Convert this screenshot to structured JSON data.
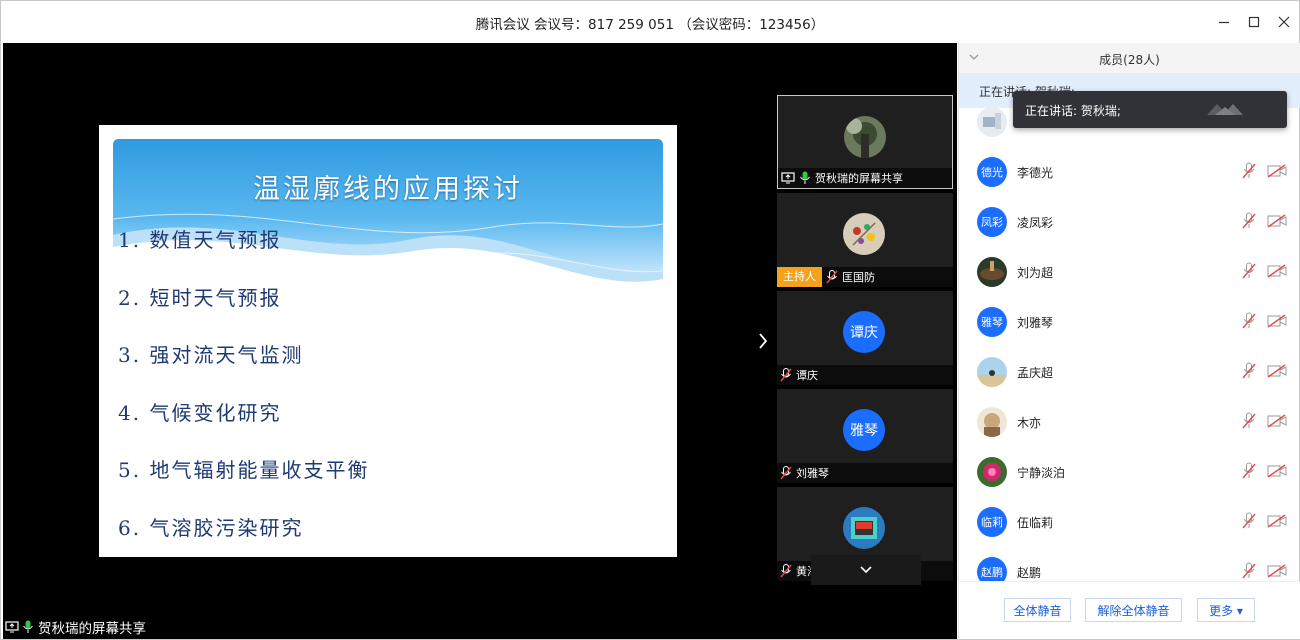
{
  "window": {
    "title": "腾讯会议 会议号：817 259 051 （会议密码：123456）"
  },
  "slide": {
    "title": "温湿廓线的应用探讨",
    "items": [
      "1. 数值天气预报",
      "2. 短时天气预报",
      "3. 强对流天气监测",
      "4. 气候变化研究",
      "5. 地气辐射能量收支平衡",
      "6. 气溶胶污染研究"
    ]
  },
  "tiles": [
    {
      "label": "贺秋瑞的屏幕共享",
      "avatar_text": ""
    },
    {
      "label": "匡国防",
      "host_badge": "主持人",
      "avatar_text": ""
    },
    {
      "label": "谭庆",
      "avatar_text": "谭庆"
    },
    {
      "label": "刘雅琴",
      "avatar_text": "雅琴"
    },
    {
      "label": "黄海平",
      "avatar_text": ""
    }
  ],
  "share_footer": "贺秋瑞的屏幕共享",
  "panel": {
    "title": "成员(28人)",
    "speaking": "正在讲话: 贺秋瑞;",
    "tooltip": "正在讲话: 贺秋瑞;",
    "members": [
      {
        "name": "",
        "avatar_text": ""
      },
      {
        "name": "李德光",
        "avatar_text": "德光"
      },
      {
        "name": "凌凤彩",
        "avatar_text": "凤彩"
      },
      {
        "name": "刘为超",
        "avatar_text": ""
      },
      {
        "name": "刘雅琴",
        "avatar_text": "雅琴"
      },
      {
        "name": "孟庆超",
        "avatar_text": ""
      },
      {
        "name": "木亦",
        "avatar_text": ""
      },
      {
        "name": "宁静淡泊",
        "avatar_text": ""
      },
      {
        "name": "伍临莉",
        "avatar_text": "临莉"
      },
      {
        "name": "赵鹏",
        "avatar_text": "赵鹏"
      }
    ],
    "buttons": {
      "mute_all": "全体静音",
      "unmute_all": "解除全体静音",
      "more": "更多 ▾"
    }
  },
  "colors": {
    "accent": "#1a6dff",
    "host_badge": "#f4a21d",
    "muted_red": "#e5484d",
    "speaking_bg": "#e3eefc"
  }
}
